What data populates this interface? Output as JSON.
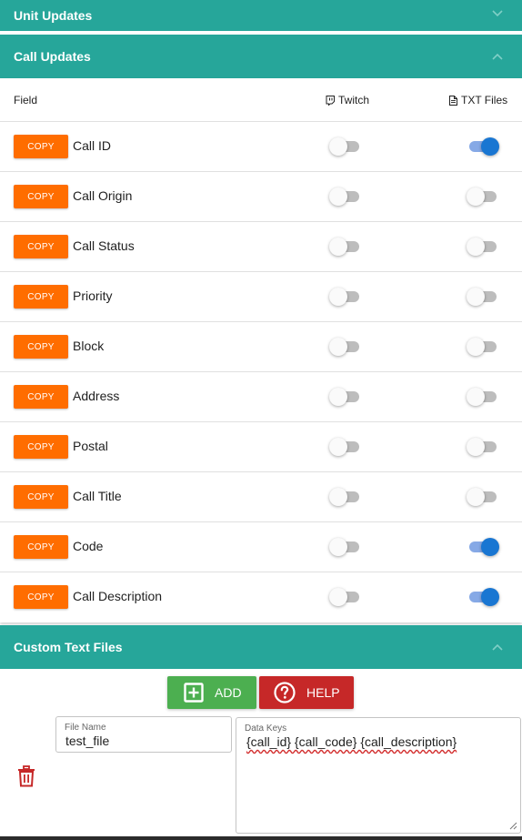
{
  "panels": {
    "unit_updates": {
      "title": "Unit Updates",
      "icon": "chevron-down-icon"
    },
    "call_updates": {
      "title": "Call Updates",
      "icon": "chevron-up-icon"
    },
    "custom_text_files": {
      "title": "Custom Text Files",
      "icon": "chevron-up-icon"
    }
  },
  "table": {
    "headers": {
      "field": "Field",
      "twitch": "Twitch",
      "txt_files": "TXT Files"
    },
    "copy_label": "COPY",
    "rows": [
      {
        "label": "Call ID",
        "twitch": false,
        "txt": true
      },
      {
        "label": "Call Origin",
        "twitch": false,
        "txt": false
      },
      {
        "label": "Call Status",
        "twitch": false,
        "txt": false
      },
      {
        "label": "Priority",
        "twitch": false,
        "txt": false
      },
      {
        "label": "Block",
        "twitch": false,
        "txt": false
      },
      {
        "label": "Address",
        "twitch": false,
        "txt": false
      },
      {
        "label": "Postal",
        "twitch": false,
        "txt": false
      },
      {
        "label": "Call Title",
        "twitch": false,
        "txt": false
      },
      {
        "label": "Code",
        "twitch": false,
        "txt": true
      },
      {
        "label": "Call Description",
        "twitch": false,
        "txt": true
      }
    ]
  },
  "custom": {
    "add_label": "ADD",
    "help_label": "HELP",
    "file_name_label": "File Name",
    "file_name_value": "test_file",
    "data_keys_label": "Data Keys",
    "data_keys_value": "{call_id} {call_code} {call_description}"
  },
  "colors": {
    "header": "#26a69a",
    "copy_button": "#ff6d00",
    "toggle_on": "#1976d2",
    "add_button": "#4caf50",
    "help_button": "#c62828",
    "delete_icon": "#c62828"
  }
}
